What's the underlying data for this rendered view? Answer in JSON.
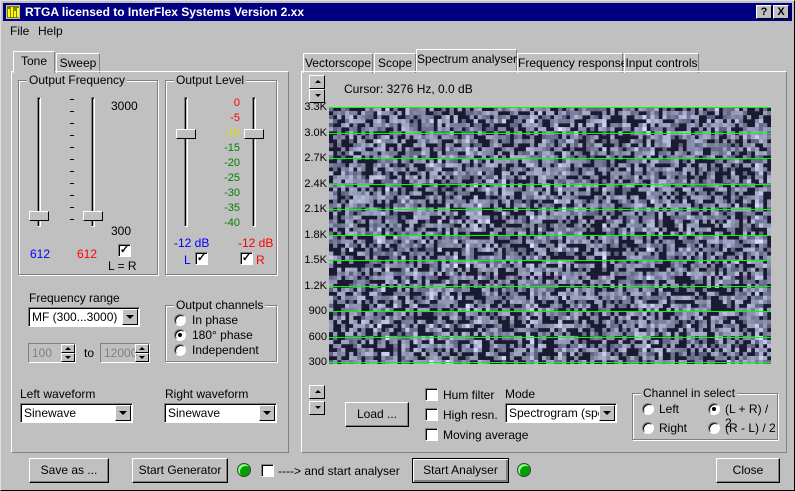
{
  "window": {
    "title": "RTGA   licensed to InterFlex Systems   Version 2.xx",
    "help_btn": "?",
    "close_btn": "X"
  },
  "menu": {
    "file": "File",
    "help": "Help"
  },
  "left_tabs": [
    "Tone",
    "Sweep"
  ],
  "output_frequency": {
    "label": "Output Frequency",
    "max_label": "3000",
    "min_label": "300",
    "left_value": "612",
    "right_value": "612",
    "link_label": "L = R",
    "link_checked": "✓",
    "left_position": 0.05,
    "right_position": 0.05
  },
  "output_level": {
    "label": "Output Level",
    "scale": [
      "0",
      "-5",
      "-10",
      "-15",
      "-20",
      "-25",
      "-30",
      "-35",
      "-40"
    ],
    "left_value": "-12 dB",
    "right_value": "-12 dB",
    "left_label": "L",
    "right_label": "R",
    "check": "✓",
    "left_position": 0.27,
    "right_position": 0.27
  },
  "frequency_range": {
    "label": "Frequency range",
    "value": "MF (300...3000)",
    "from": "100",
    "to_label": "to",
    "to": "12000"
  },
  "output_channels": {
    "label": "Output channels",
    "options": [
      "In phase",
      "180° phase",
      "Independent"
    ],
    "selected": 1
  },
  "left_waveform": {
    "label": "Left waveform",
    "value": "Sinewave"
  },
  "right_waveform": {
    "label": "Right waveform",
    "value": "Sinewave"
  },
  "right_tabs": [
    "Vectorscope",
    "Scope",
    "Spectrum analyser",
    "Frequency response",
    "Input controls"
  ],
  "active_right_tab": 2,
  "cursor_text": "Cursor: 3276 Hz,  0.0 dB",
  "spectrum_axis": [
    "3.3K",
    "3.0K",
    "2.7K",
    "2.4K",
    "2.1K",
    "1.8K",
    "1.5K",
    "1.2K",
    "900",
    "600",
    "300"
  ],
  "load_button": "Load ...",
  "hum_filter": "Hum filter",
  "high_resn": "High resn.",
  "moving_average": "Moving average",
  "mode": {
    "label": "Mode",
    "value": "Spectrogram (spee"
  },
  "channel_select": {
    "label": "Channel in select",
    "options": [
      "Left",
      "(L + R) / 2",
      "Right",
      "(R - L) / 2"
    ],
    "selected": 1
  },
  "bottom": {
    "save_as": "Save as ...",
    "start_generator": "Start Generator",
    "and_start": "----> and start analyser",
    "start_analyser": "Start Analyser",
    "close": "Close"
  },
  "colors": {
    "title_bg": "#000080",
    "led": "#00a000",
    "grid": "#00ff00",
    "blue_value": "#0000ff",
    "red_value": "#ff0000",
    "yellow_tick": "#ffff00",
    "green_tick": "#008000"
  }
}
